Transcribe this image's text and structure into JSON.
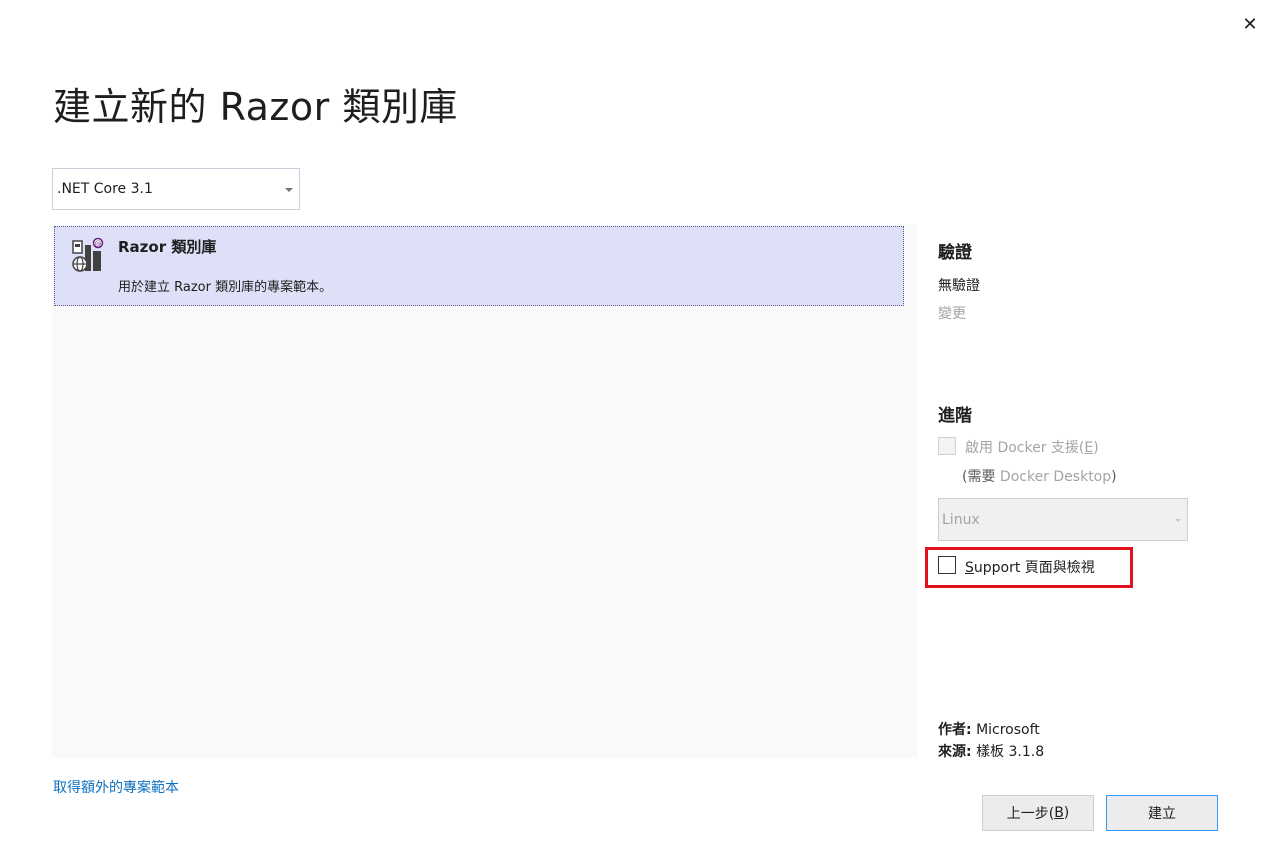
{
  "dialog": {
    "close_glyph": "✕",
    "title": "建立新的 Razor 類別庫"
  },
  "framework": {
    "selected": ".NET Core 3.1"
  },
  "template": {
    "name": "Razor 類別庫",
    "description": "用於建立 Razor 類別庫的專案範本。",
    "icon": "razor-class-library-icon"
  },
  "auth": {
    "heading": "驗證",
    "value": "無驗證",
    "change_label": "變更"
  },
  "advanced": {
    "heading": "進階",
    "docker_label_prefix": "啟用 Docker 支援(",
    "docker_label_accel": "E",
    "docker_label_suffix": ")",
    "docker_checked": false,
    "docker_requires_prefix": "(需要 ",
    "docker_requires_link": "Docker Desktop",
    "docker_requires_suffix": ")",
    "os_selected": "Linux",
    "support_accel": "S",
    "support_label_rest": "upport 頁面與檢視",
    "support_checked": false
  },
  "meta": {
    "author_label": "作者:",
    "author_value": "Microsoft",
    "source_label": "來源:",
    "source_value": "樣板 3.1.8"
  },
  "footer": {
    "more_templates_link": "取得額外的專案範本",
    "back_prefix": "上一步(",
    "back_accel": "B",
    "back_suffix": ")",
    "create_label": "建立"
  },
  "colors": {
    "accent_link": "#0e70c0",
    "selected_item_bg": "#dde0f6",
    "highlight_border": "#e0101d",
    "default_button_border": "#3399ff"
  }
}
